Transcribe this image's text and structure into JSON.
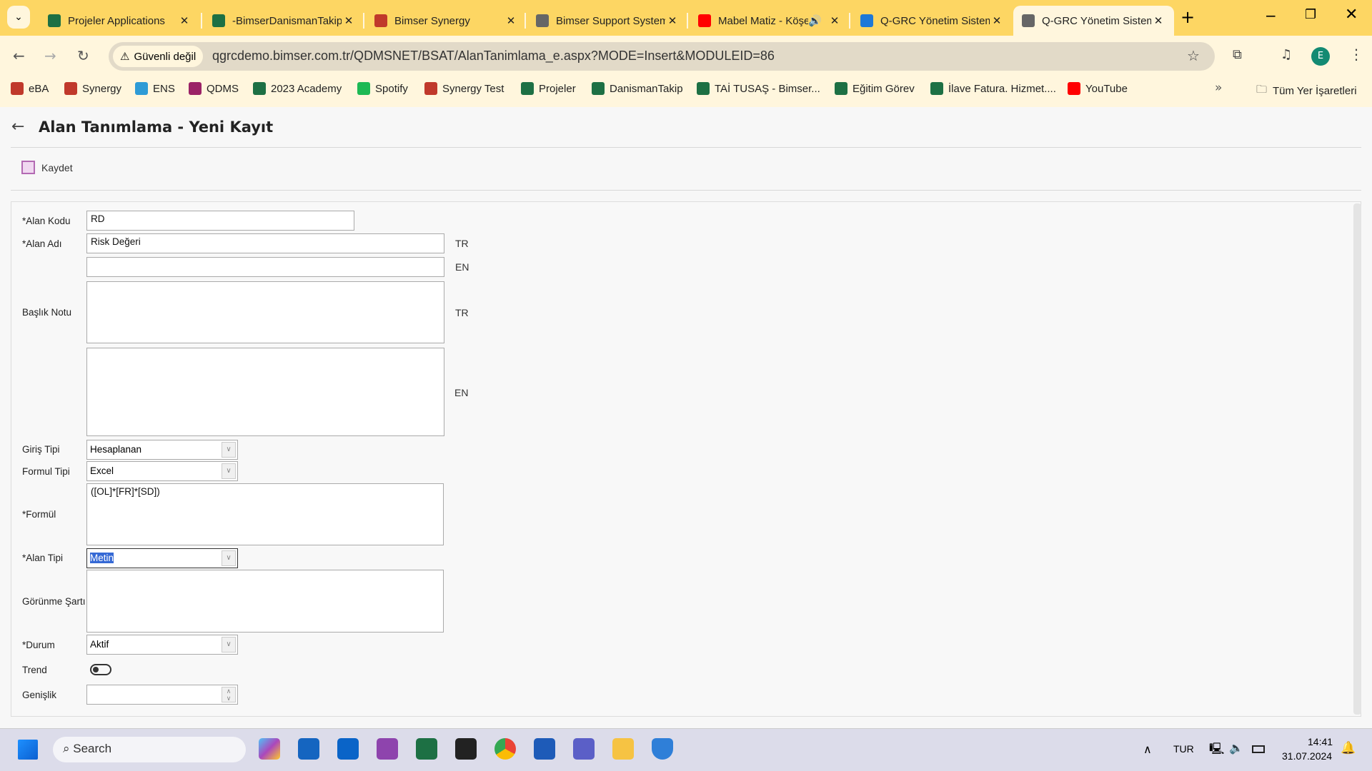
{
  "browser": {
    "tabs": [
      {
        "title": "Projeler Applications",
        "icon": "excel-icon",
        "color": "#1d7044"
      },
      {
        "title": "-BimserDanismanTakip",
        "icon": "excel-icon",
        "color": "#1d7044"
      },
      {
        "title": "Bimser Synergy",
        "icon": "synergy-icon",
        "color": "#c0392b"
      },
      {
        "title": "Bimser Support System",
        "icon": "globe-icon",
        "color": "#666666"
      },
      {
        "title": "Mabel Matiz - Köşe",
        "icon": "youtube-icon",
        "color": "#ff0000"
      },
      {
        "title": "Q-GRC Yönetim Sistemi",
        "icon": "qgrc-icon",
        "color": "#1e78d7"
      },
      {
        "title": "Q-GRC Yönetim Sistemi",
        "icon": "globe-icon",
        "color": "#666666"
      }
    ],
    "security_label": "Güvenli değil",
    "url": "qgrcdemo.bimser.com.tr/QDMSNET/BSAT/AlanTanimlama_e.aspx?MODE=Insert&MODULEID=86",
    "profile_initial": "E",
    "bookmarks": [
      {
        "label": "eBA",
        "color": "#c0392b"
      },
      {
        "label": "Synergy",
        "color": "#c0392b"
      },
      {
        "label": "ENS",
        "color": "#2e9bd6"
      },
      {
        "label": "QDMS",
        "color": "#9b2266"
      },
      {
        "label": "2023 Academy",
        "color": "#1d7044"
      },
      {
        "label": "Spotify",
        "color": "#1db954"
      },
      {
        "label": "Synergy Test",
        "color": "#c0392b"
      },
      {
        "label": "Projeler",
        "color": "#1d7044"
      },
      {
        "label": "DanismanTakip",
        "color": "#1d7044"
      },
      {
        "label": "TAİ TUSAŞ - Bimser...",
        "color": "#1d7044"
      },
      {
        "label": "Eğitim Görev",
        "color": "#1d7044"
      },
      {
        "label": "İlave Fatura. Hizmet....",
        "color": "#1d7044"
      },
      {
        "label": "YouTube",
        "color": "#ff0000"
      }
    ],
    "all_bookmarks": "Tüm Yer İşaretleri"
  },
  "page": {
    "title": "Alan Tanımlama - Yeni Kayıt",
    "save_label": "Kaydet",
    "form": {
      "alan_kodu": {
        "label": "*Alan Kodu",
        "value": "RD"
      },
      "alan_adi": {
        "label": "*Alan Adı",
        "value_tr": "Risk Değeri",
        "value_en": "",
        "lang_tr": "TR",
        "lang_en": "EN"
      },
      "baslik_notu": {
        "label": "Başlık Notu",
        "value_tr": "",
        "value_en": "",
        "lang_tr": "TR",
        "lang_en": "EN"
      },
      "giris_tipi": {
        "label": "Giriş Tipi",
        "value": "Hesaplanan"
      },
      "formul_tipi": {
        "label": "Formul Tipi",
        "value": "Excel"
      },
      "formul": {
        "label": "*Formül",
        "value": "([OL]*[FR]*[SD])"
      },
      "alan_tipi": {
        "label": "*Alan Tipi",
        "value": "Metin"
      },
      "gorunme_sarti": {
        "label": "Görünme Şartı",
        "value": ""
      },
      "durum": {
        "label": "*Durum",
        "value": "Aktif"
      },
      "trend": {
        "label": "Trend",
        "on": false
      },
      "genislik": {
        "label": "Genişlik",
        "value": ""
      }
    }
  },
  "taskbar": {
    "search_placeholder": "Search",
    "language": "TUR",
    "time": "14:41",
    "date": "31.07.2024"
  }
}
